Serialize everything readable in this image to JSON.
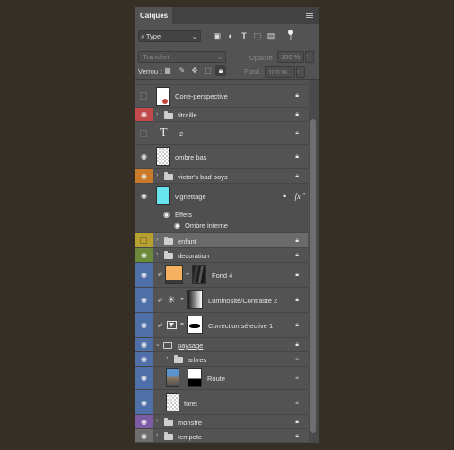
{
  "panel": {
    "title": "Calques",
    "filter_kind": "Type",
    "blend_mode": "Transfert",
    "opacity_label": "Opacité :",
    "opacity_value": "100 %",
    "lock_label": "Verrou :",
    "fill_label": "Fond :",
    "fill_value": "100 %"
  },
  "layers": [
    {
      "name": "Cone-perspective",
      "kind": "image",
      "visible": false,
      "color": null
    },
    {
      "name": "titraille",
      "kind": "group",
      "visible": true,
      "color": "#c24a4a"
    },
    {
      "name": "2",
      "kind": "text",
      "visible": false,
      "color": null
    },
    {
      "name": "ombre bas",
      "kind": "image",
      "visible": true,
      "color": null
    },
    {
      "name": "victor's bad boys",
      "kind": "group",
      "visible": true,
      "color": "#c97b2b"
    },
    {
      "name": "vignettage",
      "kind": "image",
      "visible": true,
      "color": null
    },
    {
      "name": "Effets",
      "kind": "effect-header"
    },
    {
      "name": "Ombre interne",
      "kind": "effect"
    },
    {
      "name": "enfant",
      "kind": "group",
      "visible": false,
      "color": "#b8a030"
    },
    {
      "name": "decoration",
      "kind": "group",
      "visible": true,
      "color": "#6c8a3c"
    },
    {
      "name": "Fond 4",
      "kind": "adjustment",
      "visible": true,
      "color": "#4f6fa8"
    },
    {
      "name": "Luminosité/Contraste 2",
      "kind": "adjustment",
      "visible": true,
      "color": "#4f6fa8"
    },
    {
      "name": "Correction sélective 1",
      "kind": "adjustment",
      "visible": true,
      "color": "#4f6fa8"
    },
    {
      "name": "paysage",
      "kind": "group",
      "visible": true,
      "color": "#4f6fa8"
    },
    {
      "name": "arbres",
      "kind": "group",
      "visible": true,
      "color": "#4f6fa8"
    },
    {
      "name": "Route",
      "kind": "image",
      "visible": true,
      "color": "#4f6fa8"
    },
    {
      "name": "foret",
      "kind": "image",
      "visible": true,
      "color": "#4f6fa8"
    },
    {
      "name": "monstre",
      "kind": "group",
      "visible": true,
      "color": "#7b5aa6"
    },
    {
      "name": "tempete",
      "kind": "group",
      "visible": true,
      "color": "#6e6e6e"
    }
  ]
}
